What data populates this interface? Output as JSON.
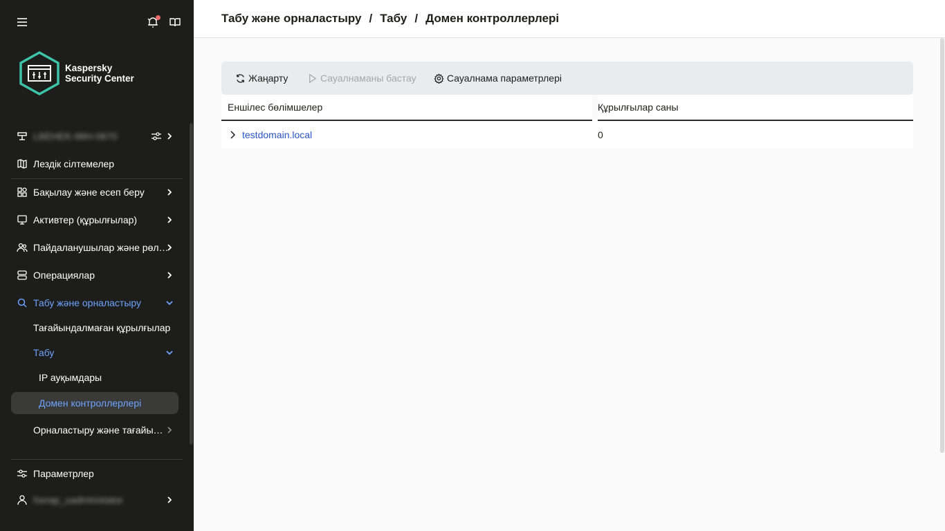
{
  "header": {
    "breadcrumb": [
      "Табу және орналастыру",
      "Табу",
      "Домен контроллерлері"
    ]
  },
  "sidebar": {
    "menu_icon": "hamburger-icon",
    "notifications_icon": "bell-icon",
    "docs_icon": "book-icon",
    "logo": {
      "line1": "Kaspersky",
      "line2": "Security Center"
    },
    "server_name": "LBEHEK-96H-0870",
    "items": [
      {
        "label": "Лездік сілтемелер",
        "icon": "map-icon"
      },
      {
        "label": "Бақылау және есеп беру",
        "icon": "dashboard-icon"
      },
      {
        "label": "Активтер (құрылғылар)",
        "icon": "monitor-icon"
      },
      {
        "label": "Пайдаланушылар және рөл…",
        "icon": "users-icon"
      },
      {
        "label": "Операциялар",
        "icon": "server-icon"
      },
      {
        "label": "Табу және орналастыру",
        "icon": "search-icon"
      },
      {
        "label": "Тағайындалмаған құрылғылар"
      },
      {
        "label": "Табу"
      },
      {
        "label": "IP ауқымдары"
      },
      {
        "label": "Домен контроллерлері"
      },
      {
        "label": "Орналастыру және тағайы…"
      },
      {
        "label": "Параметрлер",
        "icon": "sliders-icon"
      }
    ],
    "user_name": "hsnap_uadministator"
  },
  "toolbar": {
    "refresh": "Жаңарту",
    "start_poll": "Сауалнаманы бастау",
    "poll_settings": "Сауалнама параметрлері"
  },
  "table": {
    "columns": [
      "Еншілес бөлімшелер",
      "Құрылғылар саны"
    ],
    "rows": [
      {
        "name": "testdomain.local",
        "count": "0"
      }
    ]
  },
  "colors": {
    "sidebar_bg": "#1d1d1b",
    "accent": "#6ea4ff",
    "link": "#2a54c4",
    "toolbar_bg": "#e9ebee",
    "notification": "#ee6b6b"
  }
}
